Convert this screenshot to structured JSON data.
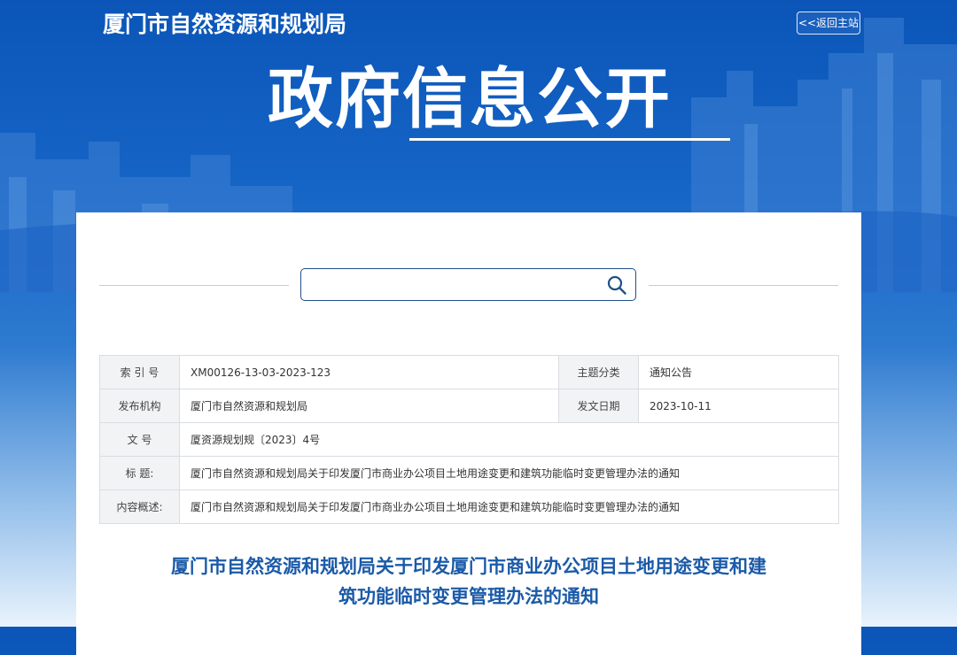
{
  "header": {
    "site_title": "厦门市自然资源和规划局",
    "back_link": "<<返回主站",
    "hero_title": "政府信息公开"
  },
  "search": {
    "value": "",
    "placeholder": ""
  },
  "info": {
    "index_no_label": "索 引 号",
    "index_no_value": "XM00126-13-03-2023-123",
    "topic_label": "主题分类",
    "topic_value": "通知公告",
    "publisher_label": "发布机构",
    "publisher_value": "厦门市自然资源和规划局",
    "date_label": "发文日期",
    "date_value": "2023-10-11",
    "doc_no_label": "文 号",
    "doc_no_value": "厦资源规划规〔2023〕4号",
    "title_label": "标 题:",
    "title_value": "厦门市自然资源和规划局关于印发厦门市商业办公项目土地用途变更和建筑功能临时变更管理办法的通知",
    "summary_label": "内容概述:",
    "summary_value": "厦门市自然资源和规划局关于印发厦门市商业办公项目土地用途变更和建筑功能临时变更管理办法的通知"
  },
  "document": {
    "title_line1": "厦门市自然资源和规划局关于印发厦门市商业办公项目土地用途变更和建",
    "title_line2": "筑功能临时变更管理办法的通知"
  },
  "colors": {
    "banner_blue": "#0b55b8",
    "title_blue": "#1b5aa8",
    "label_bg": "#f2f3f5"
  }
}
